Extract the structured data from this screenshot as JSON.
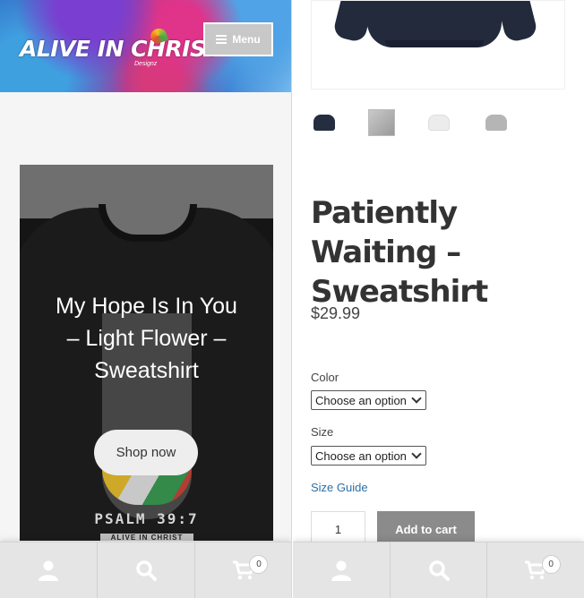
{
  "left": {
    "logo": {
      "text": "ALIVE IN CHRIST",
      "tagline": "Designz"
    },
    "menu_button": {
      "label": "Menu",
      "icon": "hamburger-icon"
    },
    "hero": {
      "title": "My Hope Is In You – Light Flower – Sweatshirt",
      "graphic_text": "PSALM 39:7",
      "graphic_brand": "ALIVE IN CHRIST",
      "button_label": "Shop now"
    },
    "footer": {
      "account_icon": "user-icon",
      "search_icon": "search-icon",
      "cart_icon": "cart-icon",
      "cart_count": "0"
    }
  },
  "right": {
    "product_title": "Patiently Waiting – Sweatshirt",
    "price": "$29.99",
    "thumbnails": [
      "navy",
      "gray",
      "white",
      "light-gray"
    ],
    "color": {
      "label": "Color",
      "selected": "Choose an option"
    },
    "size": {
      "label": "Size",
      "selected": "Choose an option"
    },
    "size_guide": "Size Guide",
    "quantity": "1",
    "add_to_cart": "Add to cart",
    "footer": {
      "account_icon": "user-icon",
      "search_icon": "search-icon",
      "cart_icon": "cart-icon",
      "cart_count": "0"
    }
  },
  "colors": {
    "link": "#2c6fa8",
    "button_gray": "#8b8b8b",
    "title": "#333333"
  }
}
